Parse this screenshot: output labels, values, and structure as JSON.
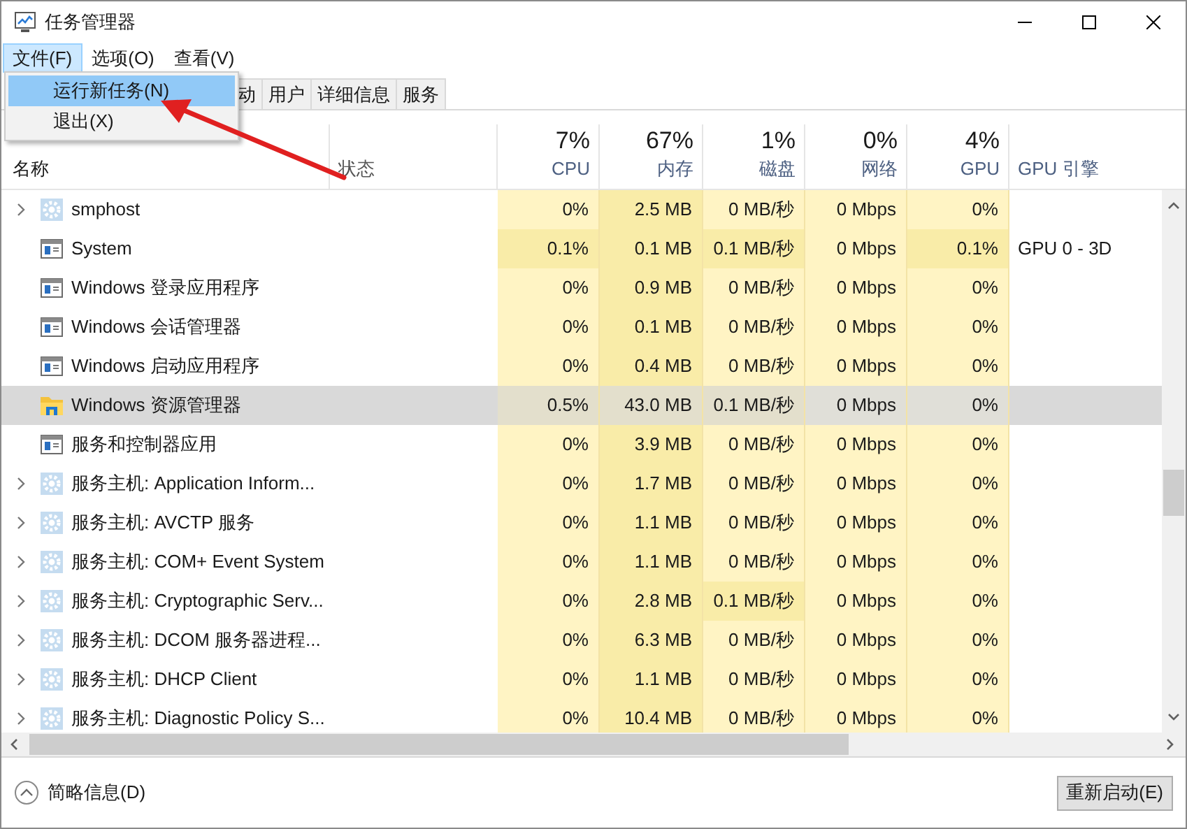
{
  "window": {
    "title": "任务管理器"
  },
  "menu_bar": [
    {
      "label": "文件(F)",
      "selected": true
    },
    {
      "label": "选项(O)",
      "selected": false
    },
    {
      "label": "查看(V)",
      "selected": false
    }
  ],
  "dropdown": [
    {
      "label": "运行新任务(N)",
      "selected": true
    },
    {
      "label": "退出(X)",
      "selected": false
    }
  ],
  "tabs": [
    {
      "label": "动",
      "selected": false
    },
    {
      "label": "用户",
      "selected": false
    },
    {
      "label": "详细信息",
      "selected": false
    },
    {
      "label": "服务",
      "selected": false
    }
  ],
  "table": {
    "columns": [
      {
        "label": "名称"
      },
      {
        "label": "状态"
      },
      {
        "percent": "7%",
        "label": "CPU"
      },
      {
        "percent": "67%",
        "label": "内存"
      },
      {
        "percent": "1%",
        "label": "磁盘"
      },
      {
        "percent": "0%",
        "label": "网络"
      },
      {
        "percent": "4%",
        "label": "GPU"
      },
      {
        "label": "GPU 引擎"
      }
    ],
    "rows": [
      {
        "kind": "service",
        "expandable": true,
        "selected": false,
        "cells": [
          {
            "text": "smphost"
          },
          {
            "text": ""
          },
          {
            "text": "0%",
            "hot": false
          },
          {
            "text": "2.5 MB",
            "hot": true
          },
          {
            "text": "0 MB/秒",
            "hot": false
          },
          {
            "text": "0 Mbps",
            "hot": false
          },
          {
            "text": "0%",
            "hot": false
          }
        ]
      },
      {
        "kind": "process",
        "expandable": false,
        "selected": false,
        "cells": [
          {
            "text": "System"
          },
          {
            "text": ""
          },
          {
            "text": "0.1%",
            "hot": true
          },
          {
            "text": "0.1 MB",
            "hot": true
          },
          {
            "text": "0.1 MB/秒",
            "hot": true
          },
          {
            "text": "0 Mbps",
            "hot": false
          },
          {
            "text": "0.1%",
            "hot": true
          },
          {
            "text": "GPU 0 - 3D"
          }
        ]
      },
      {
        "kind": "process",
        "expandable": false,
        "selected": false,
        "cells": [
          {
            "text": "Windows 登录应用程序"
          },
          {
            "text": ""
          },
          {
            "text": "0%",
            "hot": false
          },
          {
            "text": "0.9 MB",
            "hot": true
          },
          {
            "text": "0 MB/秒",
            "hot": false
          },
          {
            "text": "0 Mbps",
            "hot": false
          },
          {
            "text": "0%",
            "hot": false
          }
        ]
      },
      {
        "kind": "process",
        "expandable": false,
        "selected": false,
        "cells": [
          {
            "text": "Windows 会话管理器"
          },
          {
            "text": ""
          },
          {
            "text": "0%",
            "hot": false
          },
          {
            "text": "0.1 MB",
            "hot": true
          },
          {
            "text": "0 MB/秒",
            "hot": false
          },
          {
            "text": "0 Mbps",
            "hot": false
          },
          {
            "text": "0%",
            "hot": false
          }
        ]
      },
      {
        "kind": "process",
        "expandable": false,
        "selected": false,
        "cells": [
          {
            "text": "Windows 启动应用程序"
          },
          {
            "text": ""
          },
          {
            "text": "0%",
            "hot": false
          },
          {
            "text": "0.4 MB",
            "hot": true
          },
          {
            "text": "0 MB/秒",
            "hot": false
          },
          {
            "text": "0 Mbps",
            "hot": false
          },
          {
            "text": "0%",
            "hot": false
          }
        ]
      },
      {
        "kind": "explorer",
        "expandable": false,
        "selected": true,
        "cells": [
          {
            "text": "Windows 资源管理器"
          },
          {
            "text": ""
          },
          {
            "text": "0.5%",
            "hot": true
          },
          {
            "text": "43.0 MB",
            "hot": true
          },
          {
            "text": "0.1 MB/秒",
            "hot": true
          },
          {
            "text": "0 Mbps",
            "hot": false
          },
          {
            "text": "0%",
            "hot": false
          }
        ]
      },
      {
        "kind": "process",
        "expandable": false,
        "selected": false,
        "cells": [
          {
            "text": "服务和控制器应用"
          },
          {
            "text": ""
          },
          {
            "text": "0%",
            "hot": false
          },
          {
            "text": "3.9 MB",
            "hot": true
          },
          {
            "text": "0 MB/秒",
            "hot": false
          },
          {
            "text": "0 Mbps",
            "hot": false
          },
          {
            "text": "0%",
            "hot": false
          }
        ]
      },
      {
        "kind": "service",
        "expandable": true,
        "selected": false,
        "cells": [
          {
            "text": "服务主机: Application Inform..."
          },
          {
            "text": ""
          },
          {
            "text": "0%",
            "hot": false
          },
          {
            "text": "1.7 MB",
            "hot": true
          },
          {
            "text": "0 MB/秒",
            "hot": false
          },
          {
            "text": "0 Mbps",
            "hot": false
          },
          {
            "text": "0%",
            "hot": false
          }
        ]
      },
      {
        "kind": "service",
        "expandable": true,
        "selected": false,
        "cells": [
          {
            "text": "服务主机: AVCTP 服务"
          },
          {
            "text": ""
          },
          {
            "text": "0%",
            "hot": false
          },
          {
            "text": "1.1 MB",
            "hot": true
          },
          {
            "text": "0 MB/秒",
            "hot": false
          },
          {
            "text": "0 Mbps",
            "hot": false
          },
          {
            "text": "0%",
            "hot": false
          }
        ]
      },
      {
        "kind": "service",
        "expandable": true,
        "selected": false,
        "cells": [
          {
            "text": "服务主机: COM+ Event System"
          },
          {
            "text": ""
          },
          {
            "text": "0%",
            "hot": false
          },
          {
            "text": "1.1 MB",
            "hot": true
          },
          {
            "text": "0 MB/秒",
            "hot": false
          },
          {
            "text": "0 Mbps",
            "hot": false
          },
          {
            "text": "0%",
            "hot": false
          }
        ]
      },
      {
        "kind": "service",
        "expandable": true,
        "selected": false,
        "cells": [
          {
            "text": "服务主机: Cryptographic Serv..."
          },
          {
            "text": ""
          },
          {
            "text": "0%",
            "hot": false
          },
          {
            "text": "2.8 MB",
            "hot": true
          },
          {
            "text": "0.1 MB/秒",
            "hot": true
          },
          {
            "text": "0 Mbps",
            "hot": false
          },
          {
            "text": "0%",
            "hot": false
          }
        ]
      },
      {
        "kind": "service",
        "expandable": true,
        "selected": false,
        "cells": [
          {
            "text": "服务主机: DCOM 服务器进程..."
          },
          {
            "text": ""
          },
          {
            "text": "0%",
            "hot": false
          },
          {
            "text": "6.3 MB",
            "hot": true
          },
          {
            "text": "0 MB/秒",
            "hot": false
          },
          {
            "text": "0 Mbps",
            "hot": false
          },
          {
            "text": "0%",
            "hot": false
          }
        ]
      },
      {
        "kind": "service",
        "expandable": true,
        "selected": false,
        "cells": [
          {
            "text": "服务主机: DHCP Client"
          },
          {
            "text": ""
          },
          {
            "text": "0%",
            "hot": false
          },
          {
            "text": "1.1 MB",
            "hot": true
          },
          {
            "text": "0 MB/秒",
            "hot": false
          },
          {
            "text": "0 Mbps",
            "hot": false
          },
          {
            "text": "0%",
            "hot": false
          }
        ]
      },
      {
        "kind": "service",
        "expandable": true,
        "selected": false,
        "cells": [
          {
            "text": "服务主机: Diagnostic Policy S..."
          },
          {
            "text": ""
          },
          {
            "text": "0%",
            "hot": false
          },
          {
            "text": "10.4 MB",
            "hot": true
          },
          {
            "text": "0 MB/秒",
            "hot": false
          },
          {
            "text": "0 Mbps",
            "hot": false
          },
          {
            "text": "0%",
            "hot": false
          }
        ]
      }
    ]
  },
  "footer": {
    "details_toggle": "简略信息(D)",
    "button": "重新启动(E)"
  }
}
